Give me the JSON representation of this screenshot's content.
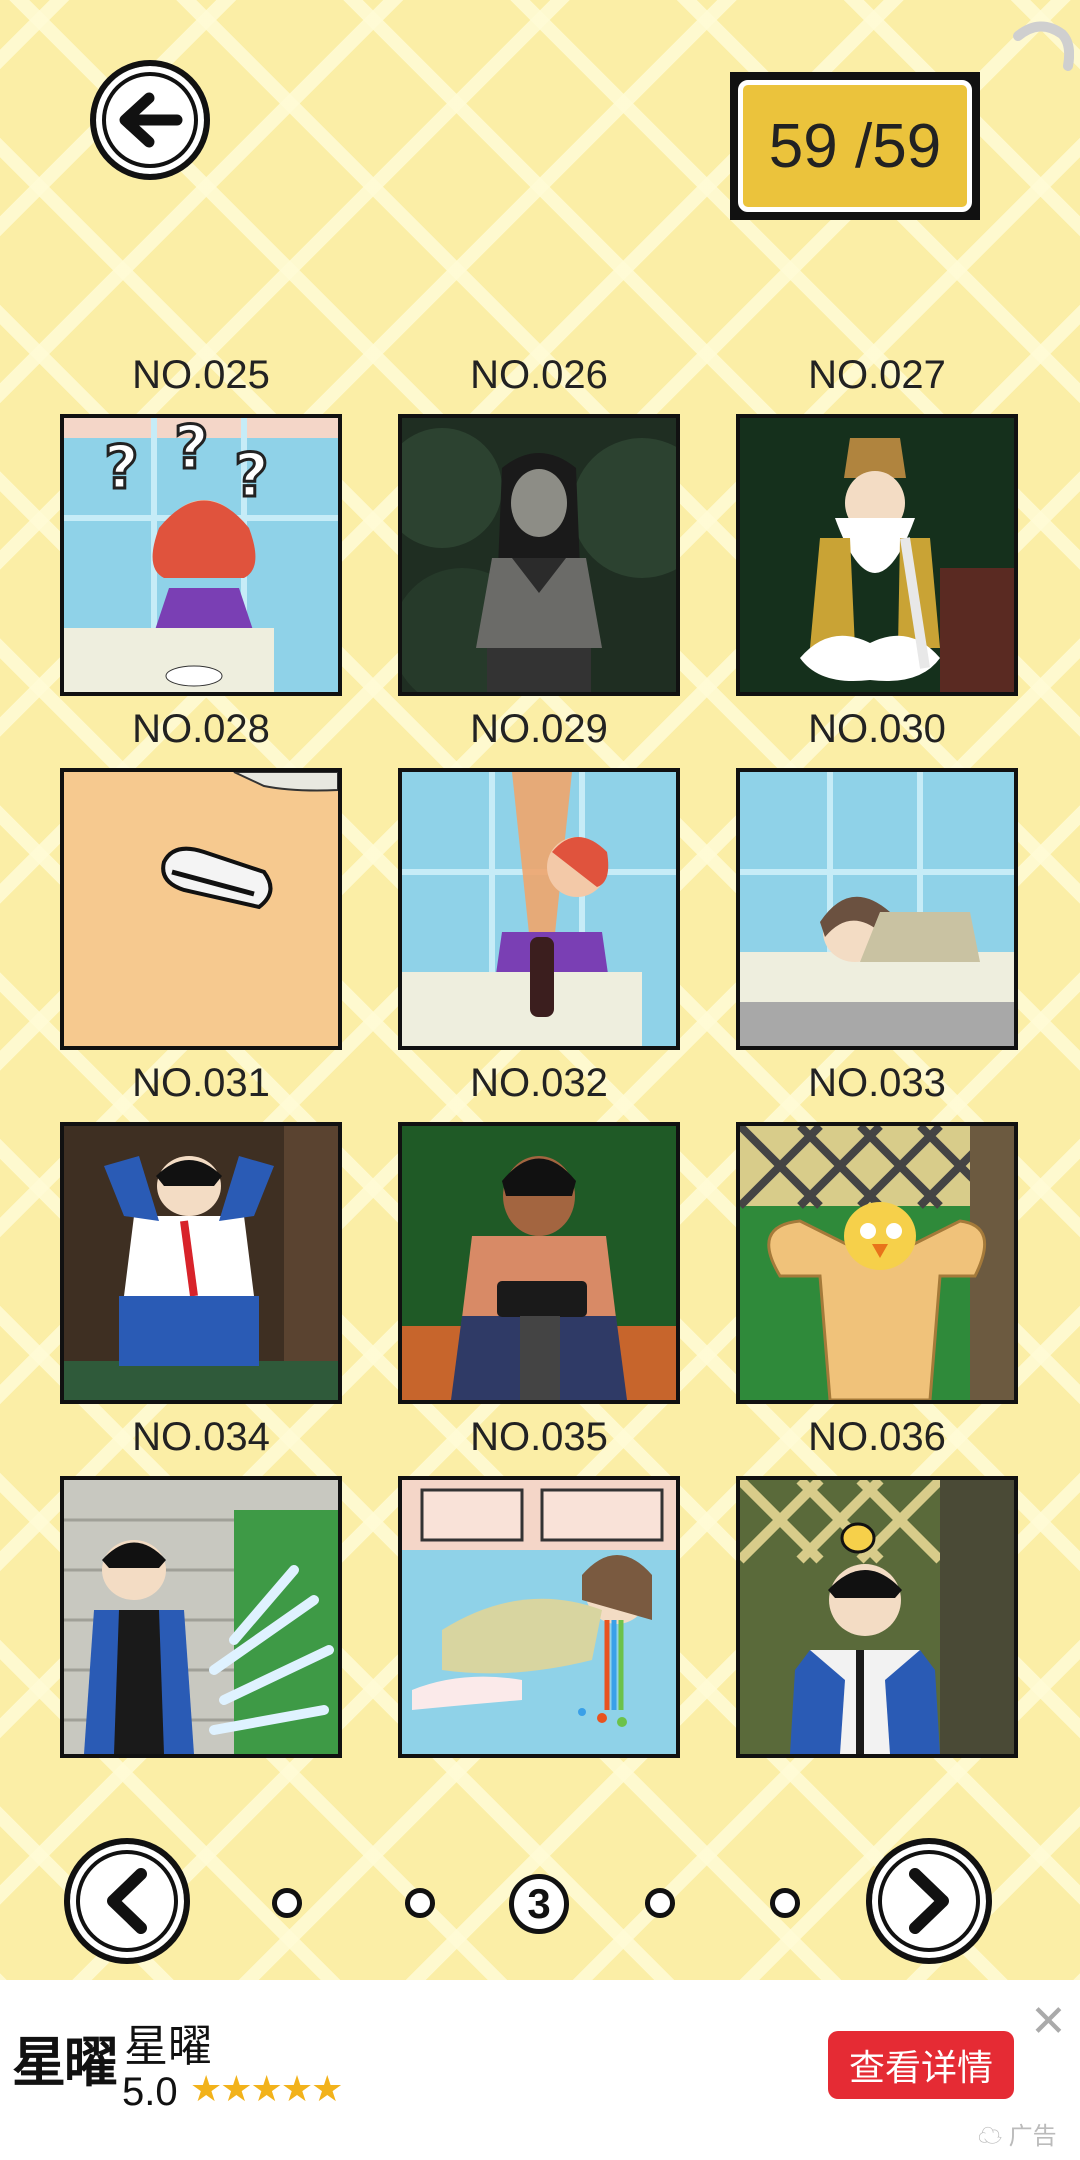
{
  "header": {
    "back_icon": "arrow-left-icon",
    "counter_text": "59 /59"
  },
  "items": [
    {
      "label": "NO.025"
    },
    {
      "label": "NO.026"
    },
    {
      "label": "NO.027"
    },
    {
      "label": "NO.028"
    },
    {
      "label": "NO.029"
    },
    {
      "label": "NO.030"
    },
    {
      "label": "NO.031"
    },
    {
      "label": "NO.032"
    },
    {
      "label": "NO.033"
    },
    {
      "label": "NO.034"
    },
    {
      "label": "NO.035"
    },
    {
      "label": "NO.036"
    }
  ],
  "pager": {
    "current_page": "3",
    "prev_icon": "chevron-left-icon",
    "next_icon": "chevron-right-icon"
  },
  "ad": {
    "logo_text": "星曜",
    "title": "星曜",
    "rating": "5.0",
    "stars": "★★★★★",
    "cta_label": "查看详情",
    "tag": "广告",
    "close_icon": "close-icon"
  },
  "colors": {
    "background": "#fbeea6",
    "counter_fill": "#ebc33c",
    "cta": "#e52b34",
    "stars": "#f2b21a"
  }
}
